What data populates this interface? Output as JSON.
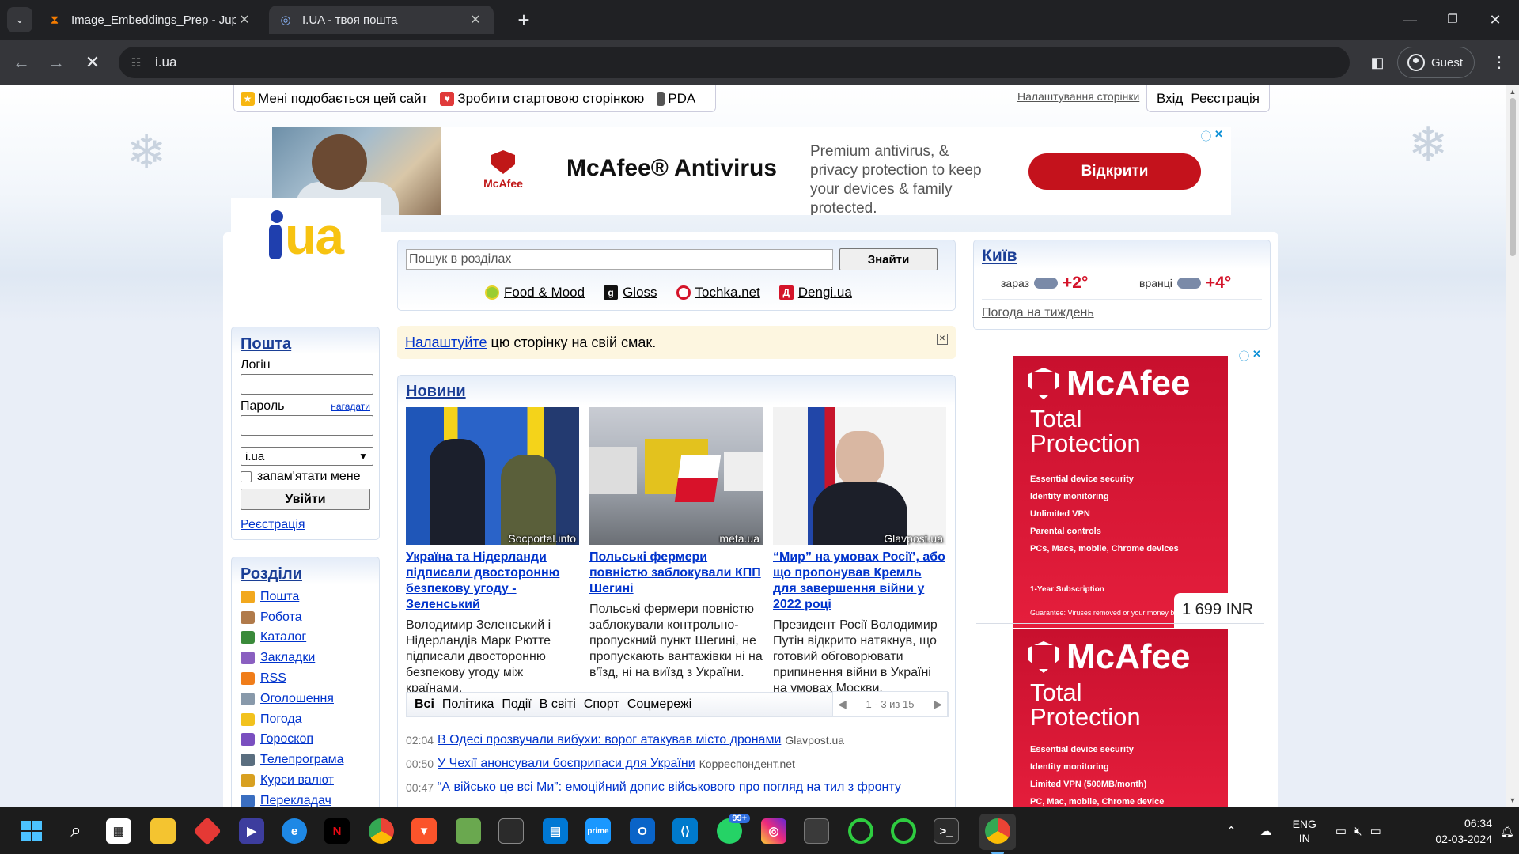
{
  "browser": {
    "tabs": [
      {
        "title": "Image_Embeddings_Prep - Jupy",
        "active": false,
        "favicon": "hourglass-icon"
      },
      {
        "title": "I.UA - твоя пошта",
        "active": true,
        "favicon": "iua-icon"
      }
    ],
    "url": "i.ua",
    "profile_label": "Guest"
  },
  "page": {
    "toplinks": {
      "like": "Мені подобається цей сайт",
      "startpage": "Зробити стартовою сторінкою",
      "pda": "PDA",
      "settings": "Налаштування сторінки",
      "login": "Вхід",
      "register": "Реєстрація"
    },
    "ad_top": {
      "brand": "McAfee",
      "headline": "McAfee® Antivirus",
      "copy": "Premium antivirus, & privacy protection to keep your devices & family protected.",
      "cta": "Відкрити",
      "cta_color": "#c4121c"
    },
    "logo": {
      "text": "ua"
    },
    "mail": {
      "title": "Пошта",
      "login_label": "Логін",
      "password_label": "Пароль",
      "remind_link": "нагадати",
      "domain_value": "i.ua",
      "remember_label": "запам'ятати мене",
      "submit_label": "Увійти",
      "register_link": "Реєстрація"
    },
    "sections": {
      "title": "Розділи",
      "items": [
        {
          "label": "Пошта",
          "icon": "mail-icon",
          "color": "#f2a81d"
        },
        {
          "label": "Робота",
          "icon": "briefcase-icon",
          "color": "#b07a4a"
        },
        {
          "label": "Каталог",
          "icon": "catalog-icon",
          "color": "#3a8a3a"
        },
        {
          "label": "Закладки",
          "icon": "bookmark-icon",
          "color": "#8a5fc0"
        },
        {
          "label": "RSS",
          "icon": "rss-icon",
          "color": "#f07d1a"
        },
        {
          "label": "Оголошення",
          "icon": "ads-icon",
          "color": "#8899aa"
        },
        {
          "label": "Погода",
          "icon": "weather-icon",
          "color": "#f2c21d"
        },
        {
          "label": "Гороскоп",
          "icon": "horoscope-icon",
          "color": "#7a4fc0"
        },
        {
          "label": "Телепрограма",
          "icon": "tv-icon",
          "color": "#5a6e7f"
        },
        {
          "label": "Курси валют",
          "icon": "money-icon",
          "color": "#d8a020"
        },
        {
          "label": "Перекладач",
          "icon": "translate-icon",
          "color": "#3a6ec0"
        }
      ]
    },
    "search": {
      "placeholder": "Пошук в розділах",
      "button": "Знайти",
      "partners": [
        {
          "label": "Food & Mood",
          "icon": "food-mood-icon",
          "color": "#9acd32"
        },
        {
          "label": "Gloss",
          "icon": "gloss-icon",
          "color": "#111111"
        },
        {
          "label": "Tochka.net",
          "icon": "tochka-icon",
          "color": "#d4142a"
        },
        {
          "label": "Dengi.ua",
          "icon": "dengi-icon",
          "color": "#d4142a"
        }
      ]
    },
    "customize": {
      "link": "Налаштуйте",
      "text": "цю сторінку на свій смак."
    },
    "news": {
      "title": "Новини",
      "cards": [
        {
          "source": "Socportal.info",
          "headline": "Україна та Нідерланди підписали двосторонню безпекову угоду - Зеленський",
          "desc": "Володимир Зеленський і Нідерландів Марк Рютте підписали двосторонню безпекову угоду між країнами."
        },
        {
          "source": "meta.ua",
          "headline": "Польські фермери повністю заблокували КПП Шегині",
          "desc": "Польські фермери повністю заблокували контрольно-пропускний пункт Шегині, не пропускають вантажівки ні на в'їзд, ні на виїзд з України."
        },
        {
          "source": "Glavpost.ua",
          "headline": "“Мир” на умовах Росії’, або що пропонував Кремль для завершення війни у 2022 році",
          "desc": "Президент Росії Володимир Путін відкрито натякнув, що готовий обговорювати припинення війни в Україні на умовах Москви."
        }
      ],
      "tabs": [
        "Всі",
        "Політика",
        "Події",
        "В світі",
        "Спорт",
        "Соцмережі"
      ],
      "pager": "1 - 3 из 15",
      "list": [
        {
          "time": "02:04",
          "title": "В Одесі прозвучали вибухи: ворог атакував місто дронами",
          "source": "Glavpost.ua"
        },
        {
          "time": "00:50",
          "title": "У Чехії анонсували боєприпаси для України",
          "source": "Корреспондент.net"
        },
        {
          "time": "00:47",
          "title": "“А військо це всі Ми”: емоційний допис військового про погляд на тил з фронту",
          "source": ""
        }
      ]
    },
    "weather": {
      "city": "Київ",
      "now_label": "зараз",
      "now_temp": "+2°",
      "morning_label": "вранці",
      "morning_temp": "+4°",
      "week_link": "Погода на тиждень"
    },
    "ad_right": {
      "brand": "McAfee",
      "product_line1": "Total",
      "product_line2": "Protection",
      "features_1": [
        "Essential device security",
        "Identity monitoring",
        "Unlimited VPN",
        "Parental controls",
        "PCs, Macs, mobile, Chrome devices"
      ],
      "subscription": "1-Year Subscription",
      "guarantee": "Guarantee: Viruses removed or your money back",
      "price": "1 699 INR",
      "features_2": [
        "Essential device security",
        "Identity monitoring",
        "Limited VPN (500MB/month)",
        "PC, Mac, mobile, Chrome device"
      ]
    }
  },
  "taskbar": {
    "whatsapp_badge": "99+",
    "lang_line1": "ENG",
    "lang_line2": "IN",
    "time": "06:34",
    "date": "02-03-2024"
  }
}
